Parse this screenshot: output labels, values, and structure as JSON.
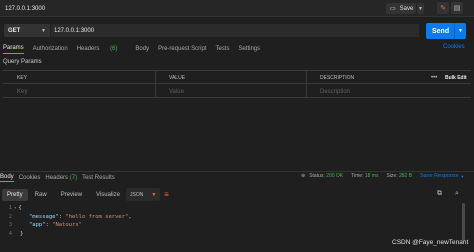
{
  "topbar": {
    "tab_title": "127.0.0.1:3000",
    "save_label": "Save",
    "save_icon": "save-icon",
    "edit_icon": "pencil-icon",
    "doc_icon": "document-icon",
    "edit_color": "#e86a4a"
  },
  "request": {
    "method": "GET",
    "url": "127.0.0.1:3000",
    "send_label": "Send",
    "send_color": "#097bed"
  },
  "req_tabs": {
    "params": "Params",
    "authorization": "Authorization",
    "headers": "Headers",
    "headers_count": "(6)",
    "body": "Body",
    "prerequest": "Pre-request Script",
    "tests": "Tests",
    "settings": "Settings",
    "cookies": "Cookies"
  },
  "query_params": {
    "title": "Query Params",
    "columns": [
      "KEY",
      "VALUE",
      "DESCRIPTION"
    ],
    "placeholders": [
      "Key",
      "Value",
      "Description"
    ],
    "more": "•••",
    "bulk_edit": "Bulk Edit"
  },
  "response": {
    "tabs": {
      "body": "Body",
      "cookies": "Cookies",
      "headers": "Headers",
      "headers_count": "(7)",
      "test_results": "Test Results"
    },
    "status_label": "Status:",
    "status_value": "200 OK",
    "time_label": "Time:",
    "time_value": "18 ms",
    "size_label": "Size:",
    "size_value": "282 B",
    "save_response": "Save Response",
    "format_tabs": [
      "Pretty",
      "Raw",
      "Preview",
      "Visualize"
    ],
    "format": "JSON",
    "code_lines": [
      {
        "n": "1",
        "text": "{"
      },
      {
        "n": "2",
        "key": "\"message\"",
        "value": "\"hello from server\"",
        "trail": ","
      },
      {
        "n": "3",
        "key": "\"app\"",
        "value": "\"Natours\"",
        "trail": ""
      },
      {
        "n": "4",
        "text": "}"
      }
    ]
  },
  "watermark": "CSDN @Faye_newTenant",
  "colors": {
    "accent": "#f26b3a",
    "success": "#3fb950",
    "link": "#097bed",
    "background": "#1f1f1f"
  }
}
